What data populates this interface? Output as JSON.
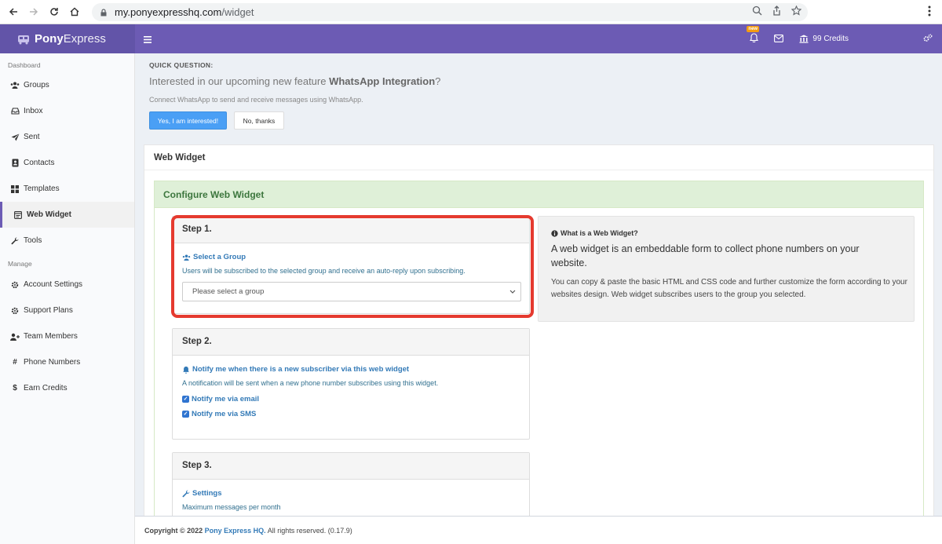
{
  "browser": {
    "url_host": "my.ponyexpresshq.com",
    "url_path": "/widget"
  },
  "app": {
    "brand_bold": "Pony",
    "brand_light": "Express",
    "new_badge": "new",
    "credits": "99 Credits"
  },
  "sidebar": {
    "section1": "Dashboard",
    "section2": "Manage",
    "items": [
      {
        "label": "Groups"
      },
      {
        "label": "Inbox"
      },
      {
        "label": "Sent"
      },
      {
        "label": "Contacts"
      },
      {
        "label": "Templates"
      },
      {
        "label": "Web Widget"
      },
      {
        "label": "Tools"
      }
    ],
    "manage_items": [
      {
        "label": "Account Settings"
      },
      {
        "label": "Support Plans"
      },
      {
        "label": "Team Members"
      },
      {
        "label": "Phone Numbers"
      },
      {
        "label": "Earn Credits"
      }
    ]
  },
  "quick_question": {
    "label": "QUICK QUESTION:",
    "title_prefix": "Interested in our upcoming new feature ",
    "title_feature": "WhatsApp Integration",
    "title_suffix": "?",
    "subtitle": "Connect WhatsApp to send and receive messages using WhatsApp.",
    "yes_label": "Yes, I am interested!",
    "no_label": "No, thanks"
  },
  "page": {
    "title": "Web Widget",
    "config_title": "Configure Web Widget"
  },
  "step1": {
    "title": "Step 1.",
    "link": "Select a Group",
    "help": "Users will be subscribed to the selected group and receive an auto-reply upon subscribing.",
    "select_placeholder": "Please select a group"
  },
  "step2": {
    "title": "Step 2.",
    "link": "Notify me when there is a new subscriber via this web widget",
    "help": "A notification will be sent when a new phone number subscribes using this widget.",
    "check_email": "Notify me via email",
    "check_sms": "Notify me via SMS"
  },
  "step3": {
    "title": "Step 3.",
    "link": "Settings",
    "help": "Maximum messages per month"
  },
  "info": {
    "title": "What is a Web Widget?",
    "lead": "A web widget is an embeddable form to collect phone numbers on your website.",
    "text": "You can copy & paste the basic HTML and CSS code and further customize the form according to your websites design. Web widget subscribes users to the group you selected."
  },
  "footer": {
    "prefix": "Copyright © 2022 ",
    "company": "Pony Express HQ.",
    "suffix": " All rights reserved. ",
    "version": "(0.17.9)"
  },
  "colors": {
    "topbar": "#6c5bb4",
    "primary_button": "#4a9ff5",
    "highlight": "#e53a2f",
    "panel_green": "#dff0d8"
  }
}
